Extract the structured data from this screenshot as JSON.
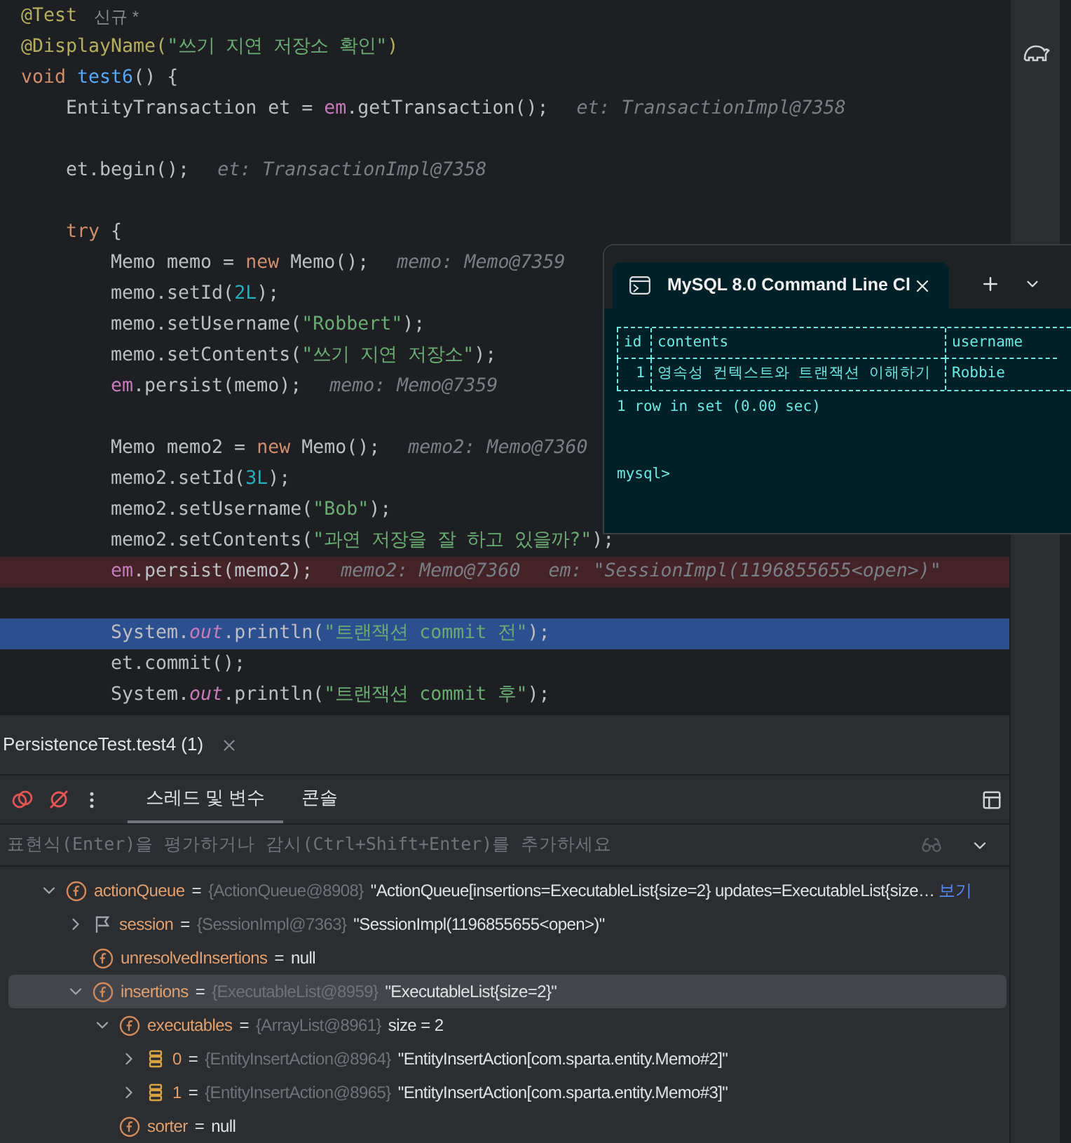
{
  "editor": {
    "lines": [
      {
        "tokens": [
          {
            "t": "@Test",
            "kind": "annotation"
          },
          {
            "t": "신규 *",
            "kind": "badge"
          }
        ]
      },
      {
        "tokens": [
          {
            "t": "@DisplayName(",
            "kind": "annotation"
          },
          {
            "t": "\"쓰기 지연 저장소 확인\"",
            "kind": "string"
          },
          {
            "t": ")",
            "kind": "annotation"
          }
        ]
      },
      {
        "tokens": [
          {
            "t": "void",
            "kind": "keyword"
          },
          {
            "t": "test6",
            "kind": "method"
          },
          {
            "t": "() {",
            "kind": "plain"
          }
        ],
        "children": [
          {
            "tokens": [
              {
                "t": "EntityTransaction et = ",
                "kind": "plain"
              },
              {
                "t": "em",
                "kind": "field"
              },
              {
                "t": ".getTransaction();",
                "kind": "plain"
              },
              {
                "t": "et: TransactionImpl@7358",
                "kind": "hint"
              }
            ]
          },
          {
            "spaced": true,
            "tokens": [
              {
                "t": "et.begin();",
                "kind": "plain"
              },
              {
                "t": "et: TransactionImpl@7358",
                "kind": "hint"
              }
            ]
          },
          {
            "spaced": true,
            "tokens": [
              {
                "t": "try",
                "kind": "keyword"
              },
              {
                "t": " {",
                "kind": "plain"
              }
            ],
            "children": [
              {
                "tokens": [
                  {
                    "t": "Memo memo = ",
                    "kind": "plain"
                  },
                  {
                    "t": "new",
                    "kind": "keyword"
                  },
                  {
                    "t": " Memo();",
                    "kind": "plain"
                  },
                  {
                    "t": "memo: Memo@7359",
                    "kind": "hint"
                  }
                ]
              },
              {
                "tokens": [
                  {
                    "t": "memo.setId(",
                    "kind": "plain"
                  },
                  {
                    "t": "2L",
                    "kind": "number"
                  },
                  {
                    "t": ");",
                    "kind": "plain"
                  }
                ]
              },
              {
                "tokens": [
                  {
                    "t": "memo.setUsername(",
                    "kind": "plain"
                  },
                  {
                    "t": "\"Robbert\"",
                    "kind": "string"
                  },
                  {
                    "t": ");",
                    "kind": "plain"
                  }
                ]
              },
              {
                "tokens": [
                  {
                    "t": "memo.setContents(",
                    "kind": "plain"
                  },
                  {
                    "t": "\"쓰기 지연 저장소\"",
                    "kind": "string"
                  },
                  {
                    "t": ");",
                    "kind": "plain"
                  }
                ]
              },
              {
                "tokens": [
                  {
                    "t": "em",
                    "kind": "field"
                  },
                  {
                    "t": ".persist(memo);",
                    "kind": "plain"
                  },
                  {
                    "t": "memo: Memo@7359",
                    "kind": "hint"
                  }
                ]
              },
              {
                "spaced": true,
                "tokens": [
                  {
                    "t": "Memo memo2 = ",
                    "kind": "plain"
                  },
                  {
                    "t": "new",
                    "kind": "keyword"
                  },
                  {
                    "t": " Memo();",
                    "kind": "plain"
                  },
                  {
                    "t": "memo2: Memo@7360",
                    "kind": "hint"
                  }
                ]
              },
              {
                "tokens": [
                  {
                    "t": "memo2.setId(",
                    "kind": "plain"
                  },
                  {
                    "t": "3L",
                    "kind": "number"
                  },
                  {
                    "t": ");",
                    "kind": "plain"
                  }
                ]
              },
              {
                "tokens": [
                  {
                    "t": "memo2.setUsername(",
                    "kind": "plain"
                  },
                  {
                    "t": "\"Bob\"",
                    "kind": "string"
                  },
                  {
                    "t": ");",
                    "kind": "plain"
                  }
                ]
              },
              {
                "tokens": [
                  {
                    "t": "memo2.setContents(",
                    "kind": "plain"
                  },
                  {
                    "t": "\"과연 저장을 잘 하고 있을까?\"",
                    "kind": "string"
                  },
                  {
                    "t": ");",
                    "kind": "plain"
                  }
                ]
              },
              {
                "kind": "breakpoint",
                "tokens": [
                  {
                    "t": "em",
                    "kind": "field"
                  },
                  {
                    "t": ".persist(memo2);",
                    "kind": "plain"
                  },
                  {
                    "t": "memo2: Memo@7360",
                    "kind": "hint"
                  },
                  {
                    "t": "em: \"SessionImpl(1196855655<open>)\"",
                    "kind": "hint"
                  }
                ]
              },
              {
                "spaced": true,
                "kind": "current",
                "tokens": [
                  {
                    "t": "System.",
                    "kind": "plain"
                  },
                  {
                    "t": "out",
                    "kind": "static"
                  },
                  {
                    "t": ".println(",
                    "kind": "plain"
                  },
                  {
                    "t": "\"트랜잭션 commit 전\"",
                    "kind": "string"
                  },
                  {
                    "t": ");",
                    "kind": "plain"
                  }
                ]
              },
              {
                "tokens": [
                  {
                    "t": "et.commit();",
                    "kind": "plain"
                  }
                ]
              },
              {
                "tokens": [
                  {
                    "t": "System.",
                    "kind": "plain"
                  },
                  {
                    "t": "out",
                    "kind": "static"
                  },
                  {
                    "t": ".println(",
                    "kind": "plain"
                  },
                  {
                    "t": "\"트랜잭션 commit 후\"",
                    "kind": "string"
                  },
                  {
                    "t": ");",
                    "kind": "plain"
                  }
                ]
              }
            ]
          }
        ]
      }
    ]
  },
  "terminal": {
    "tab_title": "MySQL 8.0 Command Line Cl",
    "columns": [
      "id",
      "contents",
      "username"
    ],
    "rows": [
      [
        "1",
        "영속성 컨텍스트와 트랜잭션 이해하기",
        "Robbie"
      ]
    ],
    "output": [
      "1 row in set (0.00 sec)"
    ],
    "prompt": "mysql>"
  },
  "debug": {
    "session_tab": "PersistenceTest.test4 (1)",
    "tabs": [
      {
        "label": "스레드 및 변수",
        "selected": true
      },
      {
        "label": "콘솔",
        "selected": false
      }
    ],
    "expression": {
      "placeholder": "표현식(Enter)을 평가하거나 감시(Ctrl+Shift+Enter)를 추가하세요"
    },
    "tree": [
      {
        "kind": "field",
        "name": "actionQueue",
        "eq": "=",
        "ref": "{ActionQueue@8908}",
        "value": "\"ActionQueue[insertions=ExecutableList{size=2} updates=ExecutableList{size…",
        "link": "보기",
        "expanded": true,
        "selected": false,
        "children": [
          {
            "kind": "flag",
            "name": "session",
            "eq": "=",
            "ref": "{SessionImpl@7363}",
            "value": "\"SessionImpl(1196855655<open>)\"",
            "expanded": false,
            "selected": false
          },
          {
            "kind": "field",
            "name": "unresolvedInsertions",
            "eq": "=",
            "value": "null",
            "selected": false
          },
          {
            "kind": "field",
            "name": "insertions",
            "eq": "=",
            "ref": "{ExecutableList@8959}",
            "value": "\"ExecutableList{size=2}\"",
            "expanded": true,
            "selected": true,
            "children": [
              {
                "kind": "field",
                "name": "executables",
                "eq": "=",
                "ref": "{ArrayList@8961}",
                "value": "size = 2",
                "expanded": true,
                "selected": false,
                "children": [
                  {
                    "kind": "list",
                    "name": "0",
                    "eq": "=",
                    "ref": "{EntityInsertAction@8964}",
                    "value": "\"EntityInsertAction[com.sparta.entity.Memo#2]\"",
                    "expanded": false,
                    "selected": false
                  },
                  {
                    "kind": "list",
                    "name": "1",
                    "eq": "=",
                    "ref": "{EntityInsertAction@8965}",
                    "value": "\"EntityInsertAction[com.sparta.entity.Memo#3]\"",
                    "expanded": false,
                    "selected": false
                  }
                ]
              },
              {
                "kind": "field",
                "name": "sorter",
                "eq": "=",
                "value": "null",
                "selected": false
              }
            ]
          }
        ]
      }
    ]
  }
}
